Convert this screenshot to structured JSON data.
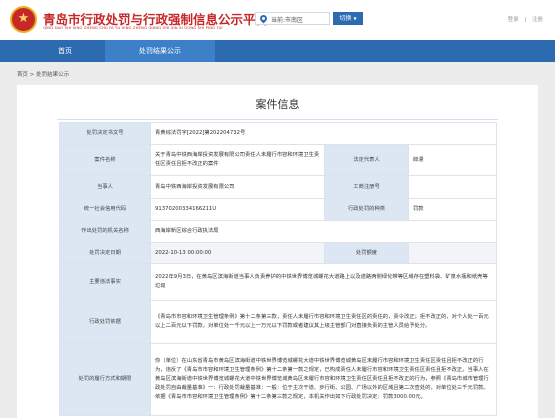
{
  "header": {
    "title": "青岛市行政处罚与行政强制信息公示平台",
    "subtitle": "QING DAO SHI XING ZHENG CHU FA YU XING ZHENG QIANG ZHI XIN XI GONG SHI PING TAI",
    "location_label": "当前:市南区",
    "switch_label": "切换",
    "login_label": "登录",
    "register_label": "注册"
  },
  "nav": {
    "home": "首页",
    "publicity": "处罚结果公示"
  },
  "breadcrumb": "首页 > 处罚结果公示",
  "case": {
    "title": "案件信息",
    "rows": {
      "doc_no_label": "处罚决定书文号",
      "doc_no": "青黄综法罚字[2022]第202204732号",
      "case_name_label": "案件名称",
      "case_name": "关于青岛中铁西海岸投资发展有限公司责任人未履行市容和环境卫生责任区责任且拒不改正的案件",
      "legal_rep_label": "法定代表人",
      "legal_rep": "郎漫",
      "party_label": "当事人",
      "party": "青岛中铁西海岸投资发展有限公司",
      "reg_no_label": "工商注册号",
      "reg_no": "",
      "credit_code_label": "统一社会信用代码",
      "credit_code": "91370200334166211U",
      "penalty_type_label": "行政处罚的种类",
      "penalty_type": "罚款",
      "authority_label": "作出处罚的机关名称",
      "authority": "西海岸新区综合行政执法局",
      "decision_date_label": "处罚决定日期",
      "decision_date": "2022-10-13 00:00:00",
      "amount_label": "处罚额度",
      "amount": "",
      "facts_label": "主要违法事实",
      "facts": "2022年9月3日，在黄岛区滨海街道当事人负责养护的中铁世界博览城螺花大道路上以及道路两侧绿化带等区域存在塑料袋、矿泉水瓶和纸壳等垃圾",
      "basis_label": "行政处罚依据",
      "basis": "《青岛市市容和环境卫生管理条例》第十二条第三款，责任人未履行市容和环境卫生责任区的责任的，责令改正；拒不改正的，对个人处一百元以上二百元以下罚款，对单位处一千元以上一万元以下罚款或者建议其上级主管部门对直接负责的主管人员给予处分。",
      "performance_label": "处罚的履行方式和期限",
      "performance": "你（单位）在山东省青岛市黄岛区滨海街道中铁世界博览城螺花大道中铁世界博览城黄岛区未履行市容和环境卫生责任区责任且拒不改正的行为，违反了《青岛市市容和环境卫生管理条例》第十二条第一款之规定，已构成责任人未履行市容和环境卫生责任区责任且拒不改正。当事人在黄岛区滨海街道中铁世界博览城螺花大道中铁世界博览城黄岛区未履行市容和环境卫生责任区责任且拒不改正的行为，参照《青岛市城市管理行政处罚自由裁量基准》一：行政处罚裁量基准：一般：位于主次干道、步行街、公园、广场以外的区域且第二次查处的，对单位处三千元罚款。依据《青岛市市容和环境卫生管理条例》第十二条第三款之规定，本机关作出如下行政处罚决定：罚款3000.00元。"
    }
  }
}
